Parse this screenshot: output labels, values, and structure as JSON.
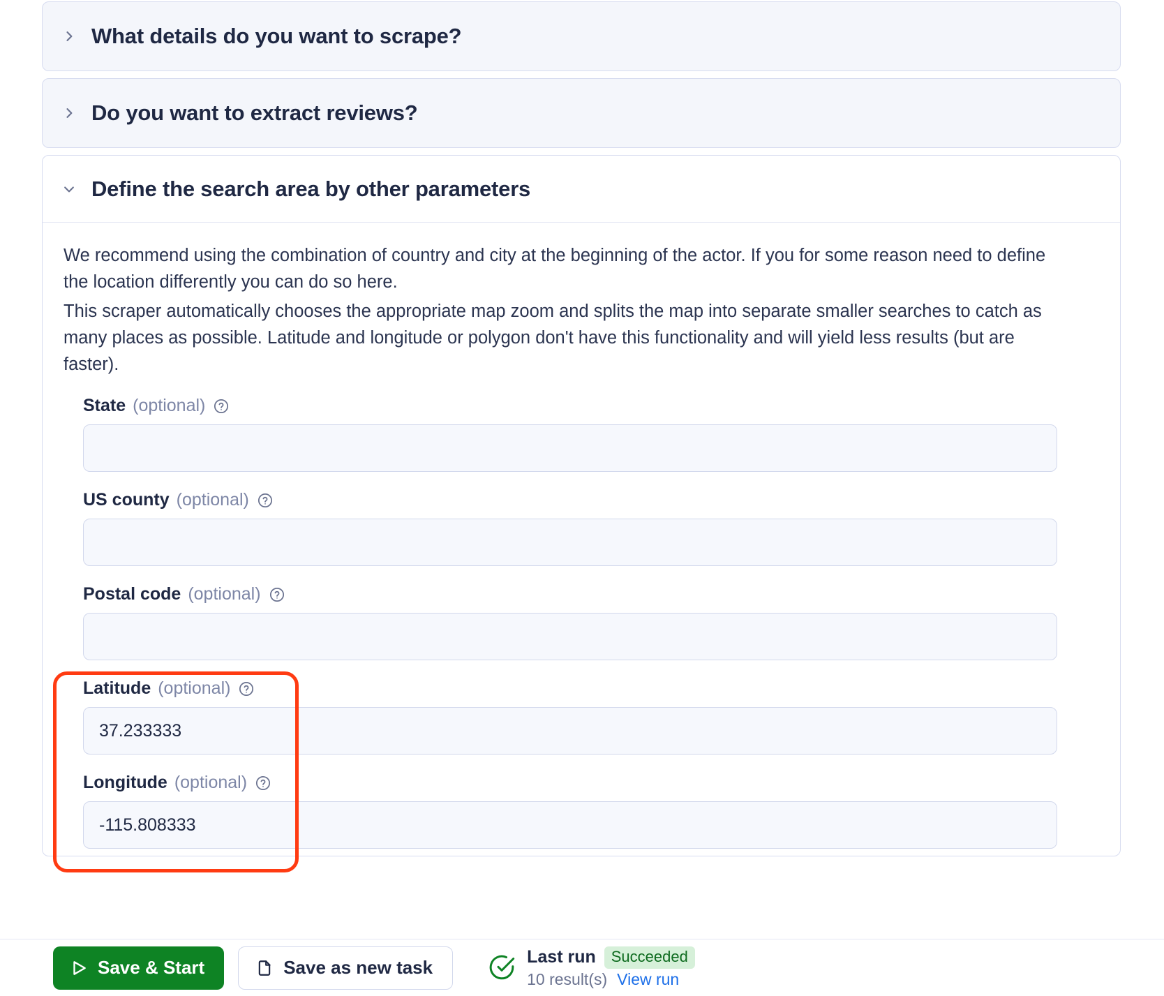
{
  "sections": [
    {
      "title": "What details do you want to scrape?",
      "expanded": false,
      "icon": "chevron-right-icon"
    },
    {
      "title": "Do you want to extract reviews?",
      "expanded": false,
      "icon": "chevron-right-icon"
    }
  ],
  "expanded_section": {
    "title": "Define the search area by other parameters",
    "icon": "chevron-down-icon",
    "description_line_1": "We recommend using the combination of country and city at the beginning of the actor. If you for some reason need to define the location differently you can do so here.",
    "description_line_2": "This scraper automatically chooses the appropriate map zoom and splits the map into separate smaller searches to catch as many places as possible. Latitude and longitude or polygon don't have this functionality and will yield less results (but are faster).",
    "fields": [
      {
        "label": "State",
        "optional": "(optional)",
        "value": "",
        "placeholder": "",
        "help_icon": "help-circle-icon"
      },
      {
        "label": "US county",
        "optional": "(optional)",
        "value": "",
        "placeholder": "",
        "help_icon": "help-circle-icon"
      },
      {
        "label": "Postal code",
        "optional": "(optional)",
        "value": "",
        "placeholder": "",
        "help_icon": "help-circle-icon"
      },
      {
        "label": "Latitude",
        "optional": "(optional)",
        "value": "37.233333",
        "placeholder": "",
        "help_icon": "help-circle-icon"
      },
      {
        "label": "Longitude",
        "optional": "(optional)",
        "value": "-115.808333",
        "placeholder": "",
        "help_icon": "help-circle-icon"
      }
    ]
  },
  "highlight": {
    "color": "#ff3b12",
    "targets": [
      "Latitude",
      "Longitude"
    ]
  },
  "footer": {
    "save_start_label": "Save & Start",
    "save_start_icon": "play-icon",
    "save_start_color": "#0e8324",
    "save_new_task_label": "Save as new task",
    "save_new_task_icon": "document-icon",
    "status_icon": "check-circle-icon",
    "last_run_label": "Last run",
    "status_badge": "Succeeded",
    "status_badge_color": "#d6f0d9",
    "result_count": "10 result(s)",
    "view_run_label": "View run",
    "view_run_color": "#1d6fe8"
  }
}
